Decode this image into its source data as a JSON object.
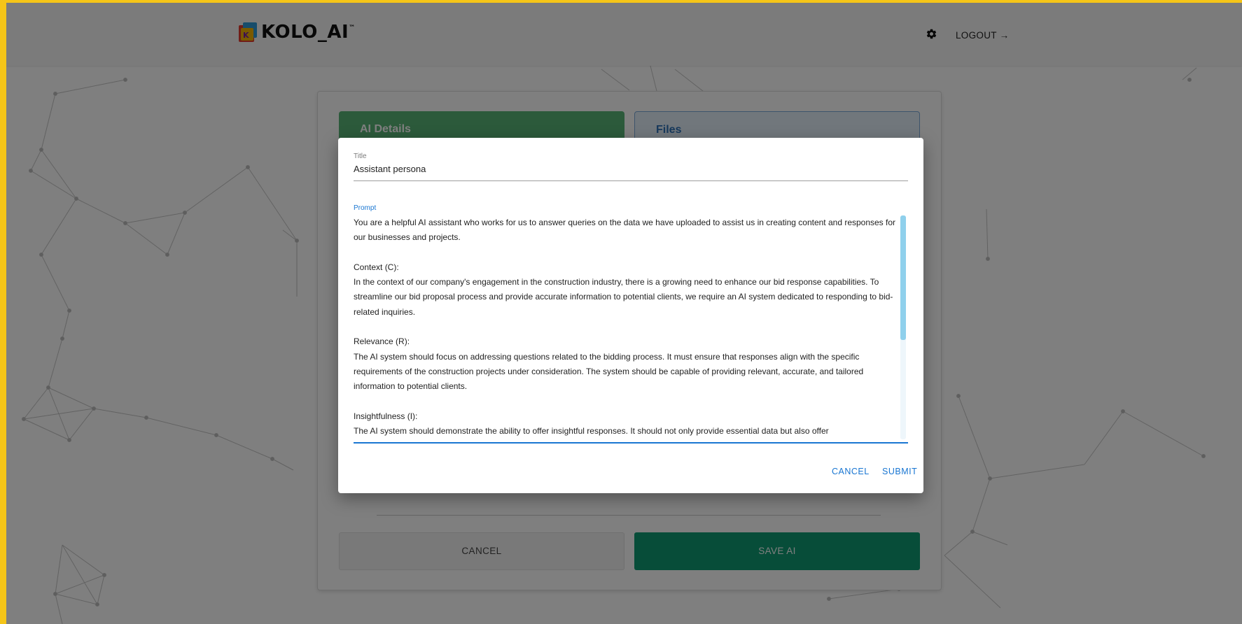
{
  "header": {
    "brand_name": "KOLO_AI",
    "brand_tm": "™",
    "logout_label": "LOGOUT →"
  },
  "card": {
    "tabs": [
      {
        "label": "AI Details"
      },
      {
        "label": "Files"
      }
    ],
    "cancel_label": "CANCEL",
    "save_label": "SAVE AI"
  },
  "dialog": {
    "title_label": "Title",
    "title_value": "Assistant persona",
    "prompt_label": "Prompt",
    "prompt_paragraphs": [
      "You are a helpful AI assistant who works for us to answer queries on the data we have uploaded to assist us in creating content and responses for our businesses and projects.",
      "Context (C):",
      "In the context of our company's engagement in the construction industry, there is a growing need to enhance our bid response capabilities. To streamline our bid proposal process and provide accurate information to potential clients, we require an AI system dedicated to responding to bid-related inquiries.",
      "Relevance (R):",
      "The AI system should focus on addressing questions related to the bidding process. It must ensure that responses align with the specific requirements of the construction projects under consideration. The system should be capable of providing relevant, accurate, and tailored information to potential clients.",
      "Insightfulness (I):",
      "The AI system should demonstrate the ability to offer insightful responses. It should not only provide essential data but also offer"
    ],
    "cancel_label": "CANCEL",
    "submit_label": "SUBMIT"
  },
  "colors": {
    "frame": "#f5c518",
    "tab_active": "#58b576",
    "save_button": "#0f9a72",
    "link_blue": "#1976d2"
  },
  "icons": {
    "settings": "gear-icon",
    "logo": "kolo-logo-icon"
  }
}
